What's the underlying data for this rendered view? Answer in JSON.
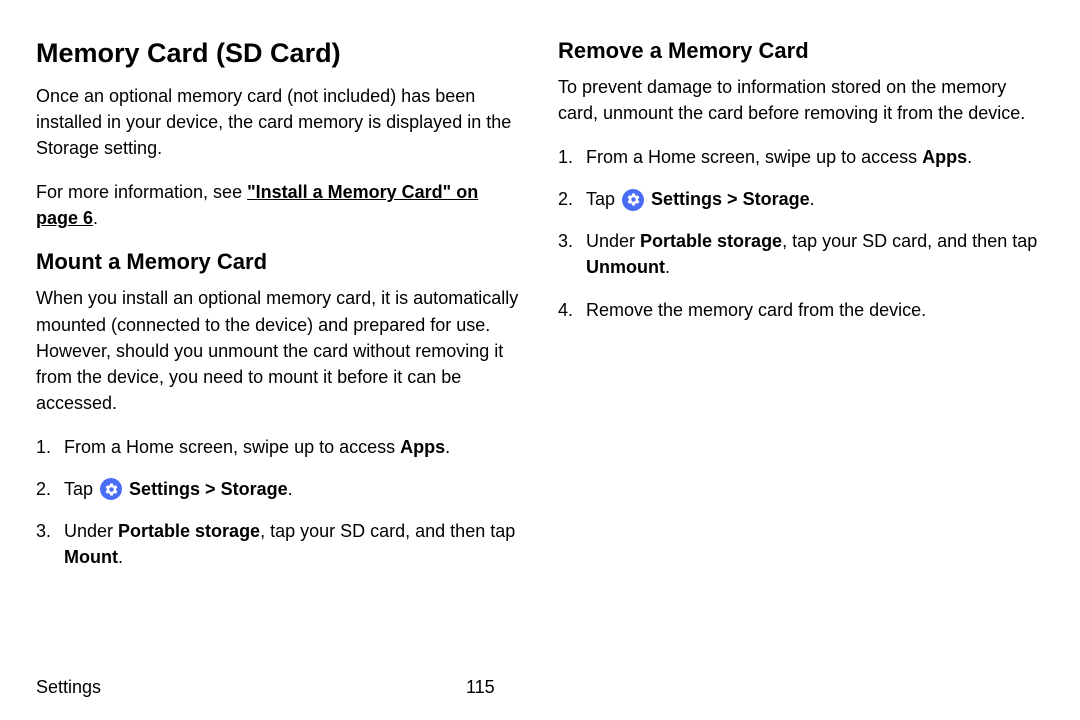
{
  "leftCol": {
    "mainHeading": "Memory Card (SD Card)",
    "intro": "Once an optional memory card (not included) has been installed in your device, the card memory is displayed in the Storage setting.",
    "moreInfoPrefix": "For more information, see ",
    "moreInfoLink": "\"Install a Memory Card\" on page 6",
    "moreInfoSuffix": ".",
    "mount": {
      "heading": "Mount a Memory Card",
      "body": "When you install an optional memory card, it is automatically mounted (connected to the device) and prepared for use. However, should you unmount the card without removing it from the device, you need to mount it before it can be accessed.",
      "step1_prefix": "From a Home screen, swipe up to access ",
      "step1_bold": "Apps",
      "step1_suffix": ".",
      "step2_prefix": "Tap ",
      "step2_bold": "Settings > Storage",
      "step2_suffix": ".",
      "step3_prefix": "Under ",
      "step3_bold1": "Portable storage",
      "step3_mid": ", tap your SD card, and then tap ",
      "step3_bold2": "Mount",
      "step3_suffix": "."
    }
  },
  "rightCol": {
    "remove": {
      "heading": "Remove a Memory Card",
      "body": "To prevent damage to information stored on the memory card, unmount the card before removing it from the device.",
      "step1_prefix": "From a Home screen, swipe up to access ",
      "step1_bold": "Apps",
      "step1_suffix": ".",
      "step2_prefix": "Tap ",
      "step2_bold": "Settings > Storage",
      "step2_suffix": ".",
      "step3_prefix": "Under ",
      "step3_bold1": "Portable storage",
      "step3_mid": ", tap your SD card, and then tap ",
      "step3_bold2": "Unmount",
      "step3_suffix": ".",
      "step4": "Remove the memory card from the device."
    }
  },
  "footer": {
    "label": "Settings",
    "page": "115"
  }
}
